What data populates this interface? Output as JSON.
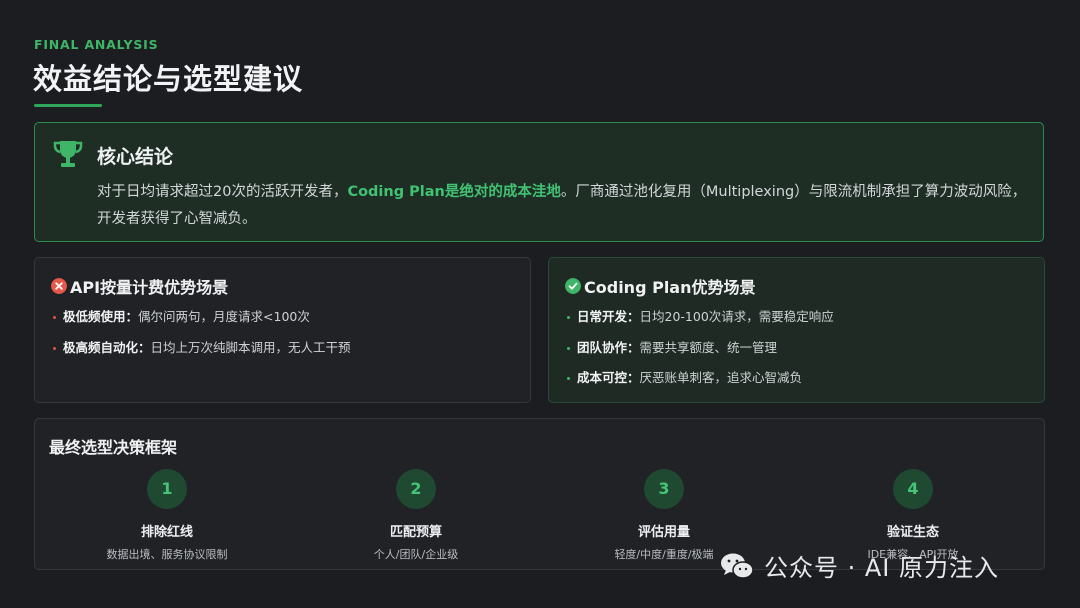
{
  "header": {
    "eyebrow": "FINAL ANALYSIS",
    "title": "效益结论与选型建议"
  },
  "core": {
    "icon": "trophy-icon",
    "heading": "核心结论",
    "text_before": "对于日均请求超过20次的活跃开发者，",
    "text_highlight": "Coding Plan是绝对的成本洼地",
    "text_after": "。厂商通过池化复用（Multiplexing）与限流机制承担了算力波动风险，开发者获得了心智减负。",
    "accent_color": "#41c272"
  },
  "api_card": {
    "icon": "x-circle-icon",
    "title": "API按量计费优势场景",
    "bullet_color": "#e0533d",
    "items": [
      {
        "key": "极低频使用：",
        "value": "偶尔问两句，月度请求<100次"
      },
      {
        "key": "极高频自动化：",
        "value": "日均上万次纯脚本调用，无人工干预"
      }
    ]
  },
  "cp_card": {
    "icon": "check-circle-icon",
    "title": "Coding Plan优势场景",
    "bullet_color": "#3fb567",
    "items": [
      {
        "key": "日常开发：",
        "value": "日均20-100次请求，需要稳定响应"
      },
      {
        "key": "团队协作：",
        "value": "需要共享额度、统一管理"
      },
      {
        "key": "成本可控：",
        "value": "厌恶账单刺客，追求心智减负"
      }
    ]
  },
  "framework": {
    "title": "最终选型决策框架",
    "steps": [
      {
        "num": "1",
        "name": "排除红线",
        "desc": "数据出境、服务协议限制"
      },
      {
        "num": "2",
        "name": "匹配预算",
        "desc": "个人/团队/企业级"
      },
      {
        "num": "3",
        "name": "评估用量",
        "desc": "轻度/中度/重度/极端"
      },
      {
        "num": "4",
        "name": "验证生态",
        "desc": "IDE兼容、API开放"
      }
    ]
  },
  "watermark": {
    "icon": "wechat-icon",
    "text": "公众号 · AI 原力注入"
  }
}
